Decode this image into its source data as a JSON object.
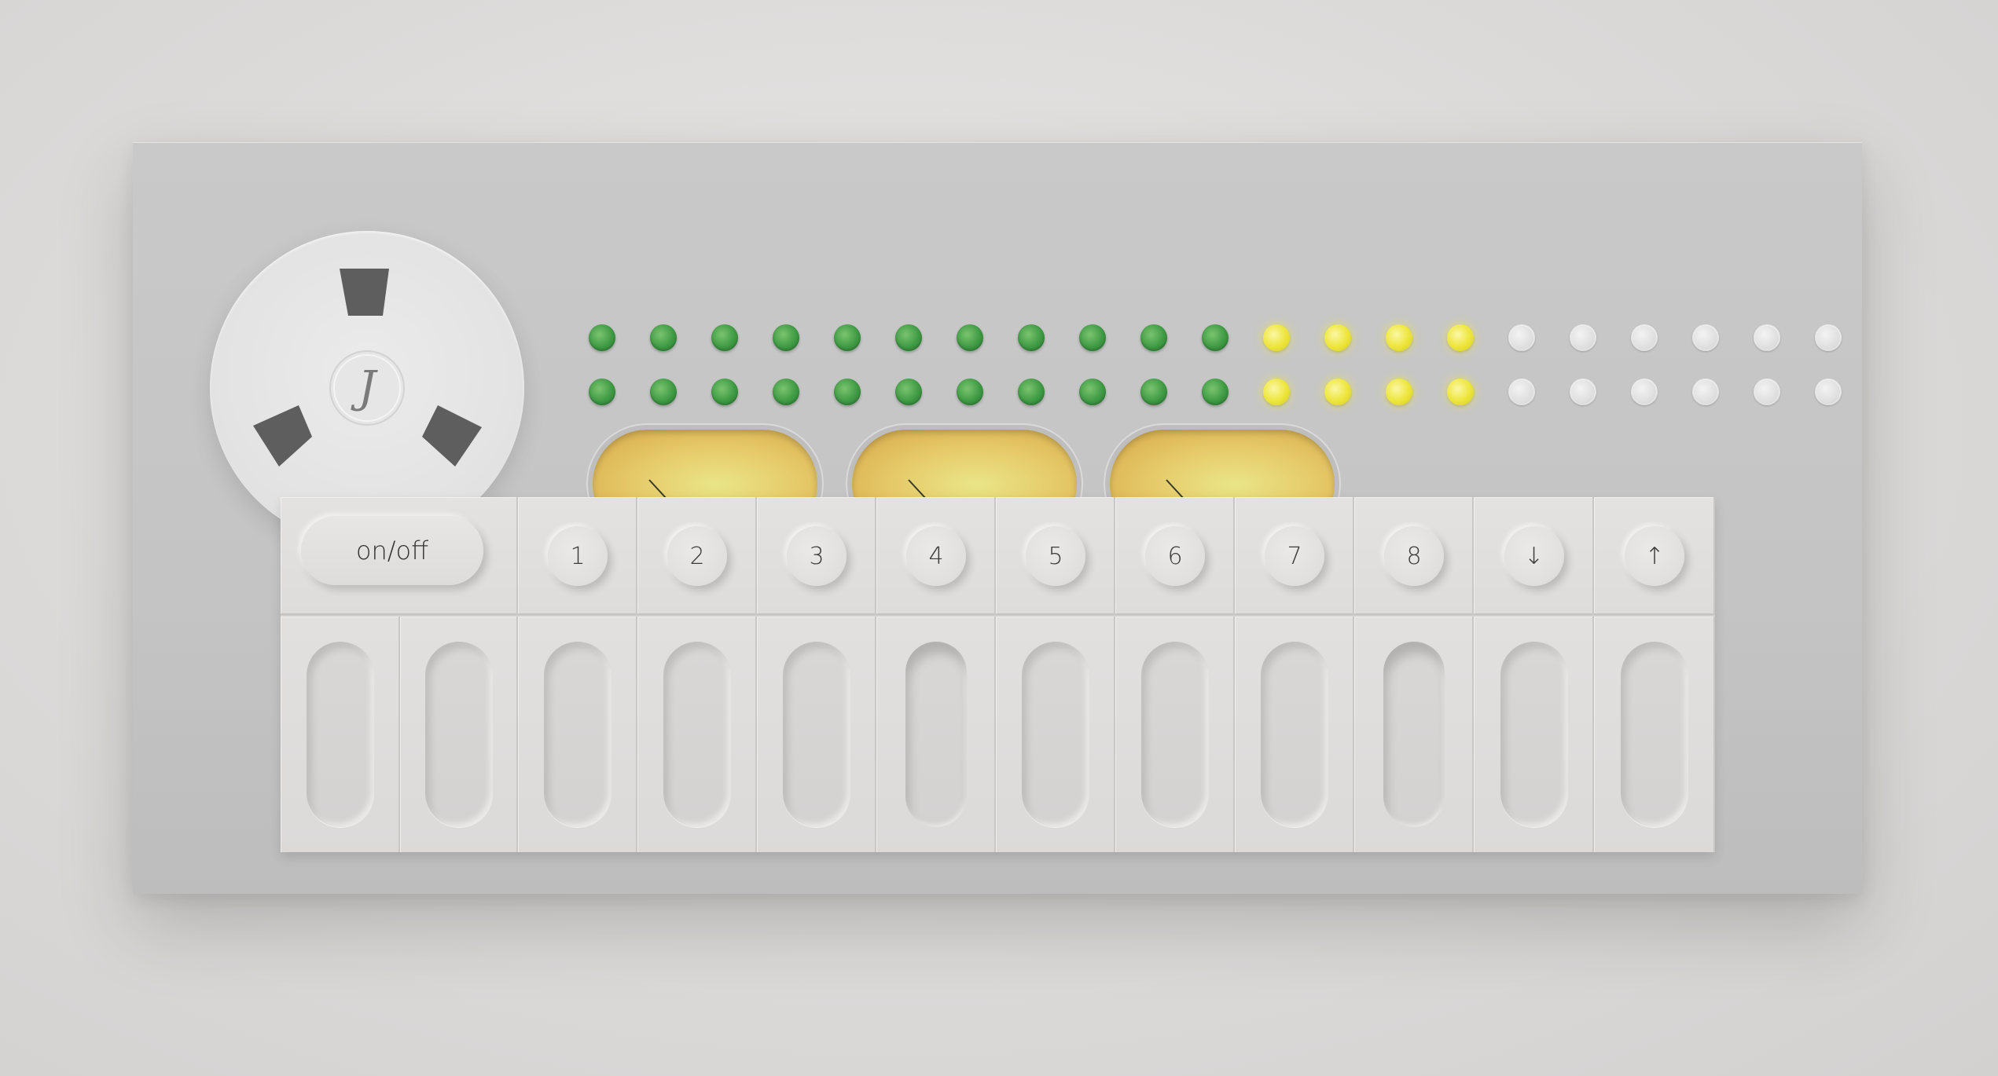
{
  "reel": {
    "logo_glyph": "J",
    "color": "#e2e2e2",
    "spoke_color": "#5e5e5e"
  },
  "leds": {
    "rows": 2,
    "columns": 21,
    "pattern": [
      "green",
      "green",
      "green",
      "green",
      "green",
      "green",
      "green",
      "green",
      "green",
      "green",
      "green",
      "yellow",
      "yellow",
      "yellow",
      "yellow",
      "off",
      "off",
      "off",
      "off",
      "off",
      "off"
    ],
    "colors": {
      "green": "#3f9a44",
      "yellow": "#ede53a",
      "off": "#dedede"
    }
  },
  "meters": [
    {
      "id": "meter-1",
      "needle_angle_deg": -40
    },
    {
      "id": "meter-2",
      "needle_angle_deg": -40
    },
    {
      "id": "meter-3",
      "needle_angle_deg": -40
    }
  ],
  "controls": {
    "power_label": "on/off",
    "number_labels": [
      "1",
      "2",
      "3",
      "4",
      "5",
      "6",
      "7",
      "8"
    ],
    "down_label": "↓",
    "up_label": "↑"
  },
  "keys": {
    "count": 12,
    "pressed": [
      5,
      9
    ]
  },
  "colors": {
    "device": "#c6c6c6",
    "keyboard": "#dedcdb",
    "background": "#d8d6d5"
  }
}
